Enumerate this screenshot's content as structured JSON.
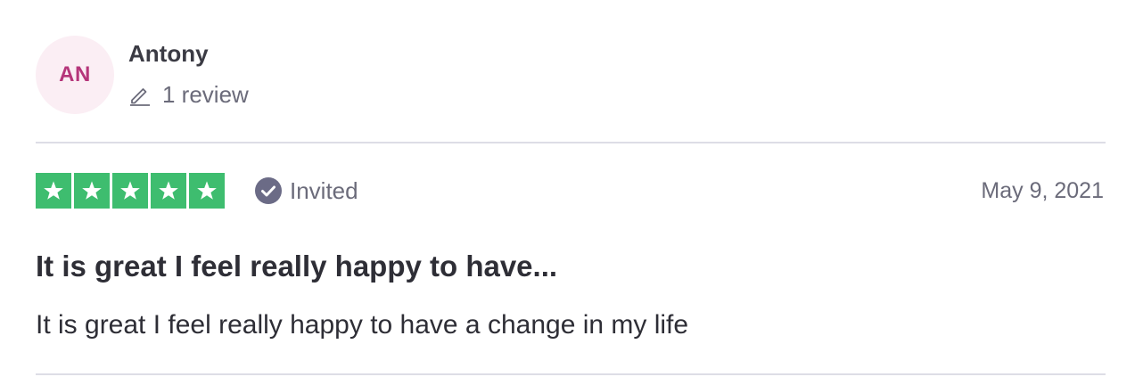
{
  "consumer": {
    "initials": "AN",
    "name": "Antony",
    "review_count": "1 review",
    "avatar_bg": "#fbeef4",
    "avatar_fg": "#b5357a"
  },
  "rating": {
    "stars": 5,
    "max": 5,
    "star_color": "#3ebd6f",
    "verification": "Invited",
    "icons": [
      "star-icon",
      "check-circle-icon",
      "pencil-icon"
    ]
  },
  "review": {
    "date": "May 9, 2021",
    "title": "It is great I feel really happy to have...",
    "body": "It is great I feel really happy to have a change in my life"
  }
}
